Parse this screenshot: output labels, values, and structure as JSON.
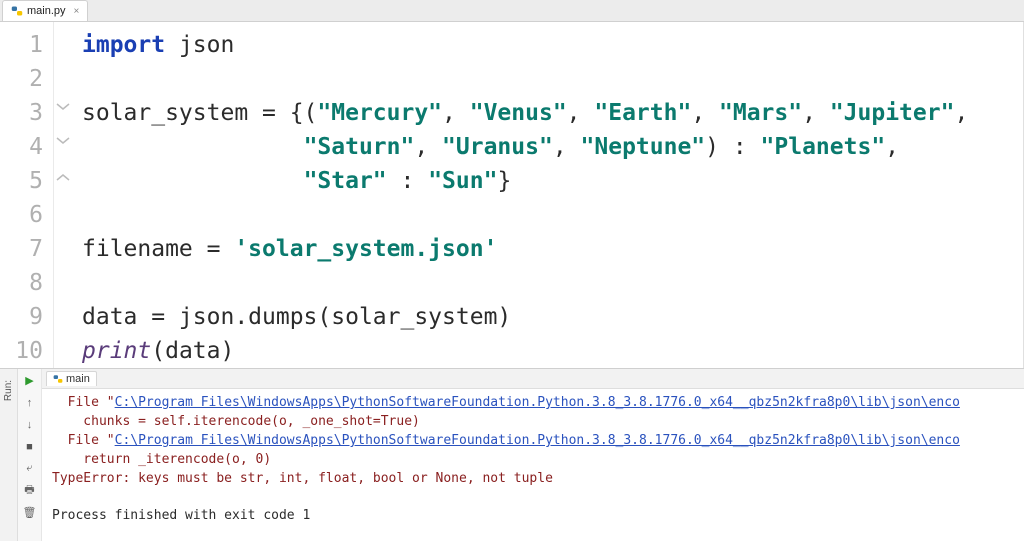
{
  "tabs": {
    "editor_tab": {
      "label": "main.py",
      "close": "×"
    }
  },
  "gutter": {
    "numbers": [
      "1",
      "2",
      "3",
      "4",
      "5",
      "6",
      "7",
      "8",
      "9",
      "10"
    ]
  },
  "code": {
    "l1": {
      "kw": "import",
      "mod": " json"
    },
    "l3": {
      "pre": "solar_system = {(",
      "s1": "\"Mercury\"",
      "c1": ", ",
      "s2": "\"Venus\"",
      "c2": ", ",
      "s3": "\"Earth\"",
      "c3": ", ",
      "s4": "\"Mars\"",
      "c4": ", ",
      "s5": "\"Jupiter\"",
      "tail": ","
    },
    "l4": {
      "indent": "                ",
      "s1": "\"Saturn\"",
      "c1": ", ",
      "s2": "\"Uranus\"",
      "c2": ", ",
      "s3": "\"Neptune\"",
      "post": ") : ",
      "s4": "\"Planets\"",
      "tail": ","
    },
    "l5": {
      "indent": "                ",
      "s1": "\"Star\"",
      "mid": " : ",
      "s2": "\"Sun\"",
      "tail": "}"
    },
    "l7": {
      "pre": "filename = ",
      "s1": "'solar_system.json'"
    },
    "l9": {
      "full": "data = json.dumps(solar_system)"
    },
    "l10": {
      "fn": "print",
      "args": "(data)"
    }
  },
  "run": {
    "panel_label": "Run:",
    "tab_label": "main",
    "tb1_file": "  File \"",
    "tb1_path": "C:\\Program Files\\WindowsApps\\PythonSoftwareFoundation.Python.3.8_3.8.1776.0_x64__qbz5n2kfra8p0\\lib\\json\\enco",
    "tb1_code": "    chunks = self.iterencode(o, _one_shot=True)",
    "tb2_file": "  File \"",
    "tb2_path": "C:\\Program Files\\WindowsApps\\PythonSoftwareFoundation.Python.3.8_3.8.1776.0_x64__qbz5n2kfra8p0\\lib\\json\\enco",
    "tb2_code": "    return _iterencode(o, 0)",
    "error": "TypeError: keys must be str, int, float, bool or None, not tuple",
    "exit": "Process finished with exit code 1"
  },
  "tools": {
    "run": "▶",
    "up": "↑",
    "down": "↓",
    "stop": "■",
    "wrap": "⤶",
    "print": "🖶",
    "trash": "🗑"
  }
}
